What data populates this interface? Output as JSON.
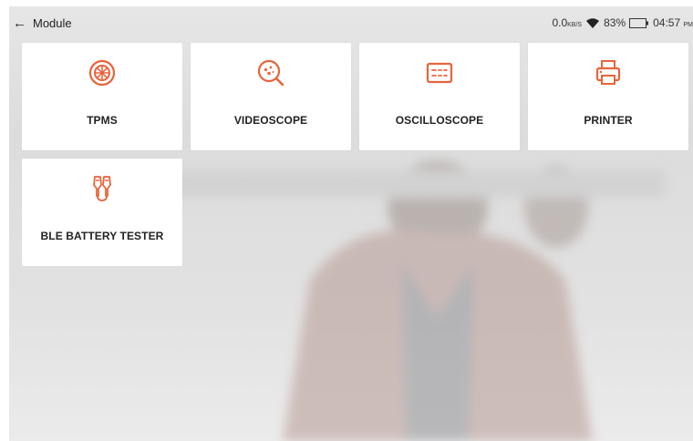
{
  "header": {
    "back_icon": "arrow-left-icon",
    "title": "Module"
  },
  "status_bar": {
    "speed_value": "0.0",
    "speed_unit": "KB/S",
    "wifi_icon": "wifi-icon",
    "battery_percent": "83%",
    "battery_icon": "battery-icon",
    "time": "04:57",
    "ampm": "PM"
  },
  "modules": [
    {
      "label": "TPMS",
      "icon": "tire-icon"
    },
    {
      "label": "VIDEOSCOPE",
      "icon": "videoscope-icon"
    },
    {
      "label": "OSCILLOSCOPE",
      "icon": "oscilloscope-icon"
    },
    {
      "label": "PRINTER",
      "icon": "printer-icon"
    },
    {
      "label": "BLE BATTERY TESTER",
      "icon": "battery-clamps-icon"
    }
  ],
  "colors": {
    "accent": "#e8643c",
    "tile_bg": "#ffffff",
    "text": "#222222"
  }
}
